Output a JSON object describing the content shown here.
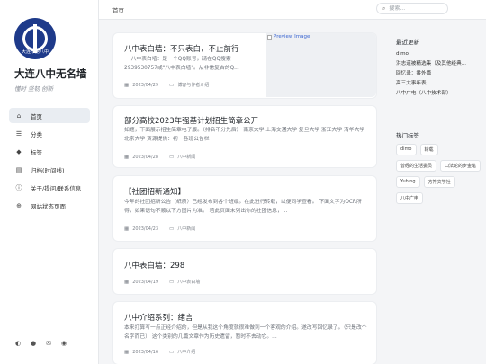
{
  "site": {
    "title": "大连八中无名墙",
    "subtitle": "懂时 坚韧 创新",
    "logo_text": "大连市第八中"
  },
  "nav": {
    "items": [
      {
        "label": "首页",
        "icon": "home-icon",
        "active": true
      },
      {
        "label": "分类",
        "icon": "list-icon"
      },
      {
        "label": "标签",
        "icon": "tag-icon"
      },
      {
        "label": "归档(时间线)",
        "icon": "archive-icon"
      },
      {
        "label": "关于/提问/联系信息",
        "icon": "info-icon"
      },
      {
        "label": "网站状态页面",
        "icon": "globe-icon"
      }
    ]
  },
  "footer_icons": [
    "theme-toggle-icon",
    "github-icon",
    "email-icon",
    "rss-icon"
  ],
  "topbar": {
    "breadcrumb": "首页",
    "search_placeholder": "搜索..."
  },
  "posts": [
    {
      "title": "八中表白墙：不只表白，不止前行",
      "excerpt": "一 八中表白墙：是一个QQ账号，请在QQ搜索2939530757或\"八中表白墙\"。从非常复古的Q...",
      "date": "2023/04/29",
      "category": "博客与作者介绍",
      "preview_alt": "Preview Image"
    },
    {
      "title": "部分高校2023年强基计划招生简章公开",
      "excerpt": "如题，下面展示招生简章电子版。（排名不分先后） 南京大学 上海交通大学 复旦大学 浙江大学 清华大学 北京大学 资源提供：初一各班公告栏",
      "date": "2023/04/28",
      "category": "八中新闻"
    },
    {
      "title": "【社团招新通知】",
      "excerpt": "今年的社团招新公告（纸质）已经发布到各个班级。在此进行转载，以便同学查看。 下面文字为OCR所得，如果语句不顺以下方图片为准。 若此页面未列出你的社团信息，...",
      "date": "2023/04/23",
      "category": "八中新闻"
    },
    {
      "title": "八中表白墙：298",
      "excerpt": "",
      "date": "2023/04/19",
      "category": "八中表白墙"
    },
    {
      "title": "八中介绍系列：绪言",
      "excerpt": "本来打算写一点正经介绍的，但是从我这个角度就很难做到一个客观的介绍。遂改写回忆录了。（只是改个名字而已） 这个类别的几篇文章作为历史遗留，暂时不去动它。...",
      "date": "2023/04/16",
      "category": "八中介绍"
    }
  ],
  "recent": {
    "title": "最近更新",
    "items": [
      "dimo",
      "洪志道被精选集（及其他经典...",
      "回忆录：番外篇",
      "高三大事年表",
      "八中广电（八中技术部）"
    ]
  },
  "tags_section": {
    "title": "热门标签",
    "items": [
      "dimo",
      "转载",
      "曾经的生活委员",
      "口法论的步金笔",
      "Yuhing",
      "方符文学社",
      "八中广电"
    ]
  }
}
